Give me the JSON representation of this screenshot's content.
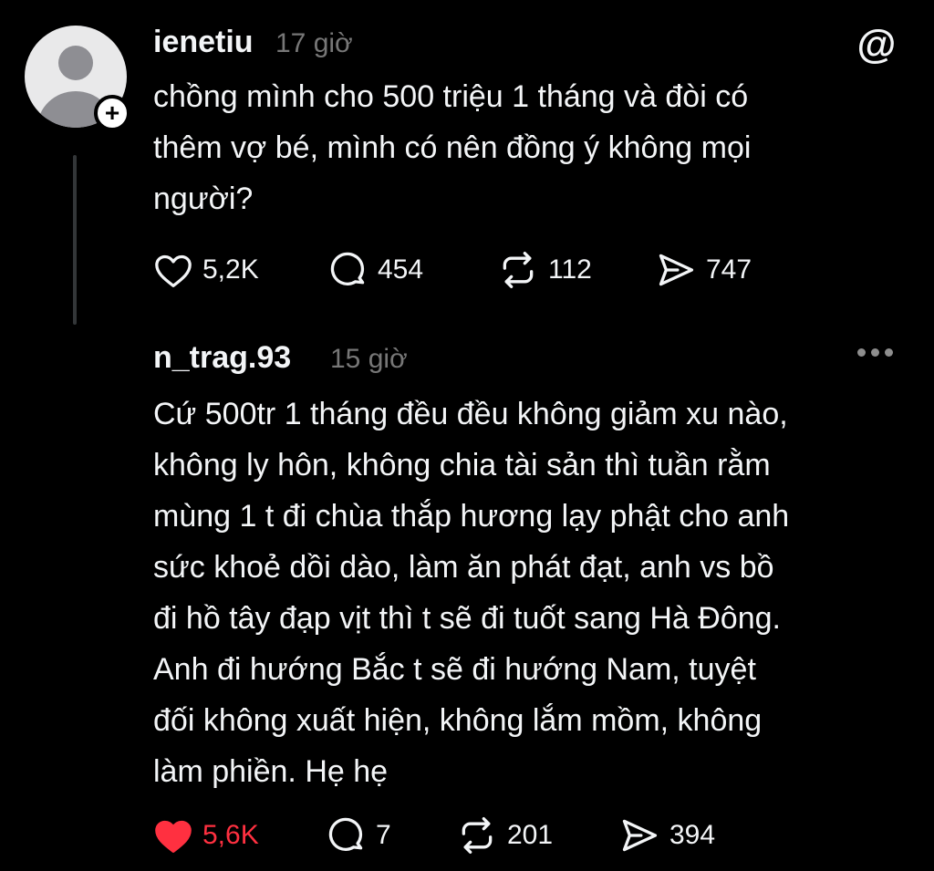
{
  "post": {
    "username": "ienetiu",
    "time": "17 giờ",
    "follow_symbol": "+",
    "text": "chồng mình cho 500 triệu 1 tháng và đòi có\nthêm vợ bé, mình có nên đồng ý không mọi\nngười?",
    "actions": {
      "likes": "5,2K",
      "comments": "454",
      "reposts": "112",
      "shares": "747"
    }
  },
  "app_logo": "@",
  "reply": {
    "username": "n_trag.93",
    "time": "15 giờ",
    "text": "Cứ 500tr 1 tháng đều đều không giảm xu nào,\nkhông ly hôn, không chia tài sản thì tuần rằm\nmùng 1 t đi chùa thắp hương lạy phật cho anh\nsức khoẻ dồi dào, làm ăn phát đạt, anh vs bồ\nđi hồ tây đạp vịt thì t sẽ đi tuốt sang Hà Đông.\nAnh đi hướng Bắc t sẽ đi hướng Nam, tuyệt\nđối không xuất hiện, không lắm mồm, không\nlàm phiền. Hẹ hẹ",
    "actions": {
      "likes": "5,6K",
      "comments": "7",
      "reposts": "201",
      "shares": "394"
    }
  },
  "colors": {
    "background": "#000000",
    "text": "#f3f5f7",
    "muted": "#777777",
    "liked": "#ff3040"
  }
}
